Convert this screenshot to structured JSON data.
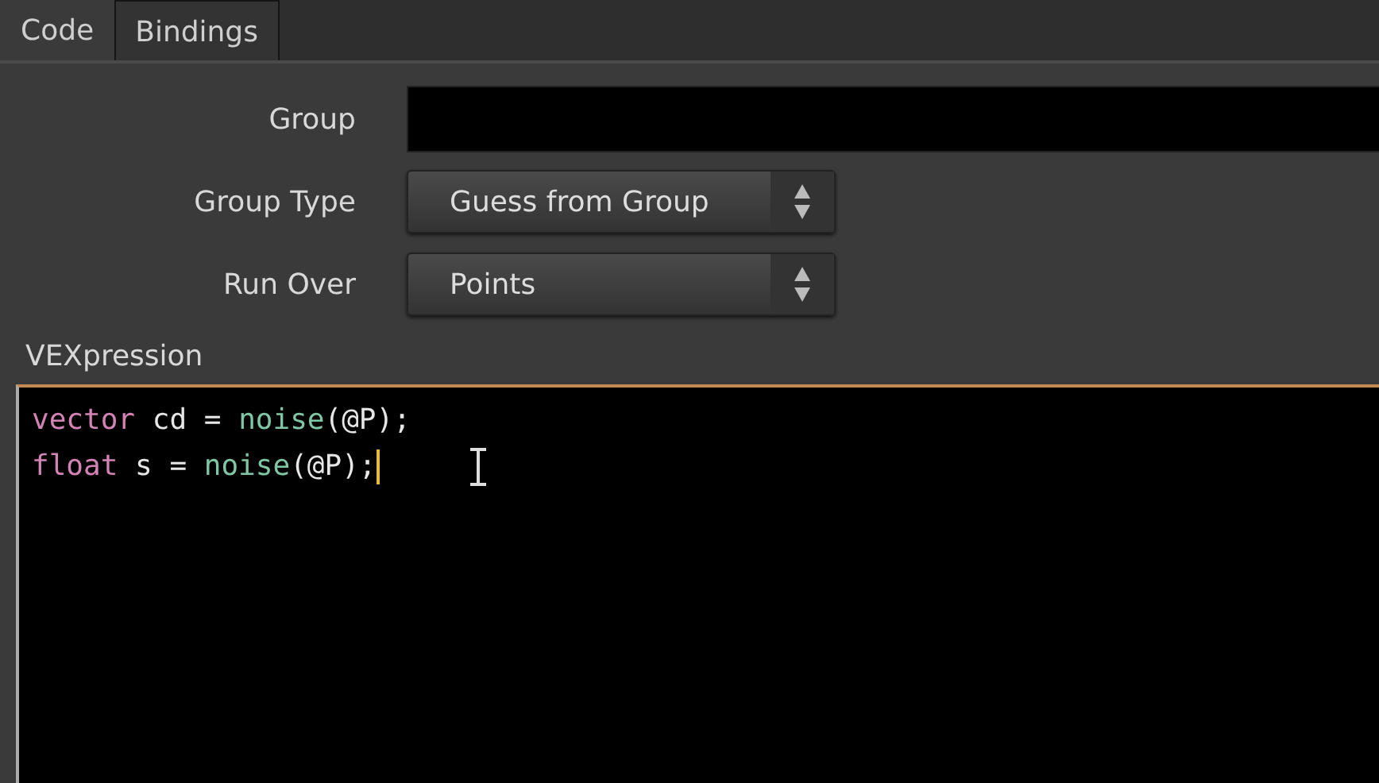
{
  "tabs": [
    {
      "label": "Code",
      "selected": true
    },
    {
      "label": "Bindings",
      "selected": false
    }
  ],
  "parameters": [
    {
      "kind": "text",
      "label": "Group"
    },
    {
      "kind": "menu",
      "label": "Group Type",
      "value": "Guess from Group"
    },
    {
      "kind": "menu",
      "label": "Run Over",
      "value": "Points"
    }
  ],
  "editor": {
    "label": "VEXpression",
    "focused": true,
    "lines": [
      {
        "caret": false,
        "tokens": [
          {
            "kind": "type",
            "text": "vector"
          },
          {
            "kind": "plain",
            "text": " cd = "
          },
          {
            "kind": "function",
            "text": "noise"
          },
          {
            "kind": "plain",
            "text": "(@P);"
          }
        ]
      },
      {
        "caret": true,
        "tokens": [
          {
            "kind": "type",
            "text": "float"
          },
          {
            "kind": "plain",
            "text": " s = "
          },
          {
            "kind": "function",
            "text": "noise"
          },
          {
            "kind": "plain",
            "text": "(@P);"
          }
        ]
      }
    ]
  }
}
